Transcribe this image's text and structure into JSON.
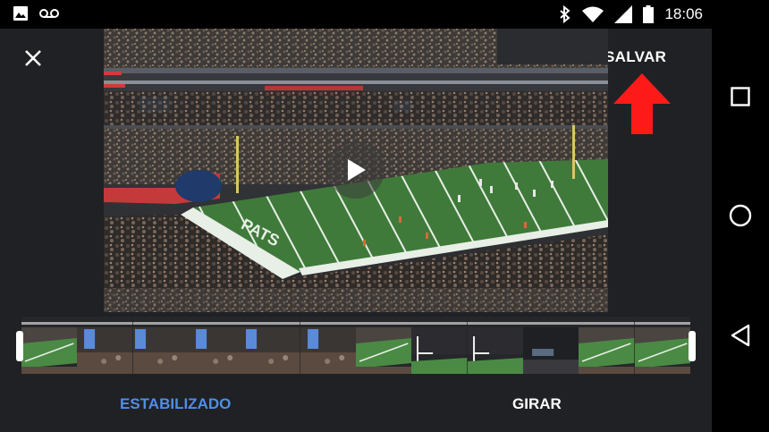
{
  "status_bar": {
    "time": "18:06",
    "icons": [
      "image-icon",
      "voicemail-icon",
      "bluetooth-icon",
      "wifi-icon",
      "cell-signal-icon",
      "battery-icon"
    ]
  },
  "toolbar": {
    "close_icon": "close-icon",
    "save_label": "SALVAR"
  },
  "annotation": {
    "arrow_color": "#ff1a1a"
  },
  "video": {
    "play_icon": "play-icon"
  },
  "filmstrip": {
    "frames": [
      "field",
      "stadium-screen",
      "stadium-screen",
      "stadium-screen",
      "stadium-screen",
      "stadium-screen",
      "field",
      "goal-post",
      "goal-post",
      "stadium-night",
      "field",
      "field"
    ]
  },
  "actions": {
    "stabilize_label": "ESTABILIZADO",
    "rotate_label": "GIRAR",
    "active_color": "#4f8ee8"
  },
  "nav_bar": {
    "buttons": [
      "recents-icon",
      "home-icon",
      "back-icon"
    ]
  }
}
